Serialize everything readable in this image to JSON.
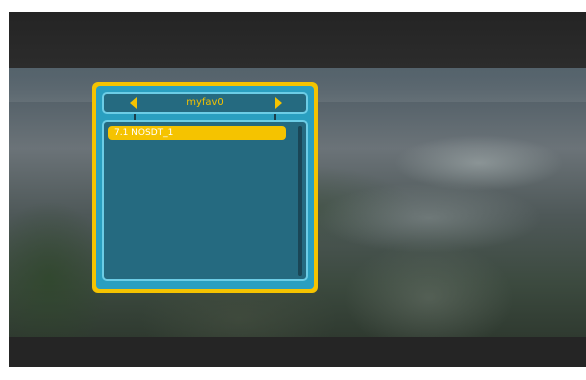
{
  "favorites": {
    "group_name": "myfav0",
    "channels": [
      {
        "label": "7.1 NOSDT_1",
        "selected": true
      }
    ]
  },
  "colors": {
    "panel_border": "#f5c300",
    "panel_fill": "#2a9fc0",
    "list_fill": "#256a80",
    "highlight": "#f5c300",
    "title_text": "#f5c300"
  },
  "icons": {
    "prev": "triangle-left-icon",
    "next": "triangle-right-icon"
  }
}
